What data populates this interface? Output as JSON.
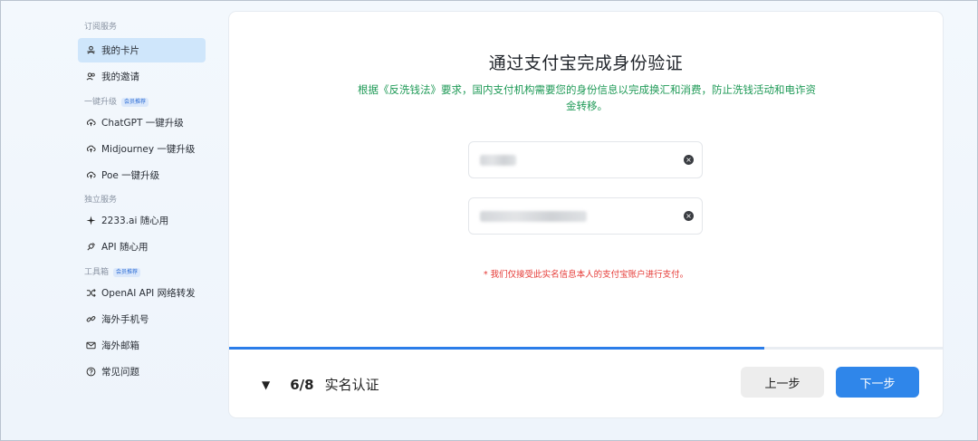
{
  "sidebar": {
    "sections": [
      {
        "label": "订阅服务",
        "badge": null,
        "items": [
          {
            "label": "我的卡片",
            "icon": "card-icon",
            "active": true
          },
          {
            "label": "我的邀请",
            "icon": "users-icon",
            "active": false
          }
        ]
      },
      {
        "label": "一键升级",
        "badge": "会员推荐",
        "items": [
          {
            "label": "ChatGPT 一键升级",
            "icon": "upload-cloud-icon"
          },
          {
            "label": "Midjourney 一键升级",
            "icon": "upload-cloud-icon"
          },
          {
            "label": "Poe 一键升级",
            "icon": "upload-cloud-icon"
          }
        ]
      },
      {
        "label": "独立服务",
        "badge": null,
        "items": [
          {
            "label": "2233.ai 随心用",
            "icon": "sparkle-icon"
          },
          {
            "label": "API 随心用",
            "icon": "plug-icon"
          }
        ]
      },
      {
        "label": "工具箱",
        "badge": "会员推荐",
        "items": [
          {
            "label": "OpenAI API 网络转发",
            "icon": "shuffle-icon"
          },
          {
            "label": "海外手机号",
            "icon": "link-icon"
          },
          {
            "label": "海外邮箱",
            "icon": "mail-icon"
          },
          {
            "label": "常见问题",
            "icon": "help-icon"
          }
        ]
      }
    ]
  },
  "main": {
    "title": "通过支付宝完成身份验证",
    "subtitle": "根据《反洗钱法》要求，国内支付机构需要您的身份信息以完成换汇和消费，防止洗钱活动和电诈资金转移。",
    "fields": [
      {
        "name": "name-field",
        "value": ""
      },
      {
        "name": "id-number-field",
        "value": ""
      }
    ],
    "warning": "* 我们仅接受此实名信息本人的支付宝账户进行支付。",
    "progress": 0.75,
    "step_count": "6/8",
    "step_label": "实名认证",
    "caret": "▼",
    "prev_label": "上一步",
    "next_label": "下一步"
  },
  "colors": {
    "accent": "#2f86ea",
    "success_text": "#1f9a57",
    "warning_text": "#e53935",
    "active_nav": "#cfe6fb"
  }
}
